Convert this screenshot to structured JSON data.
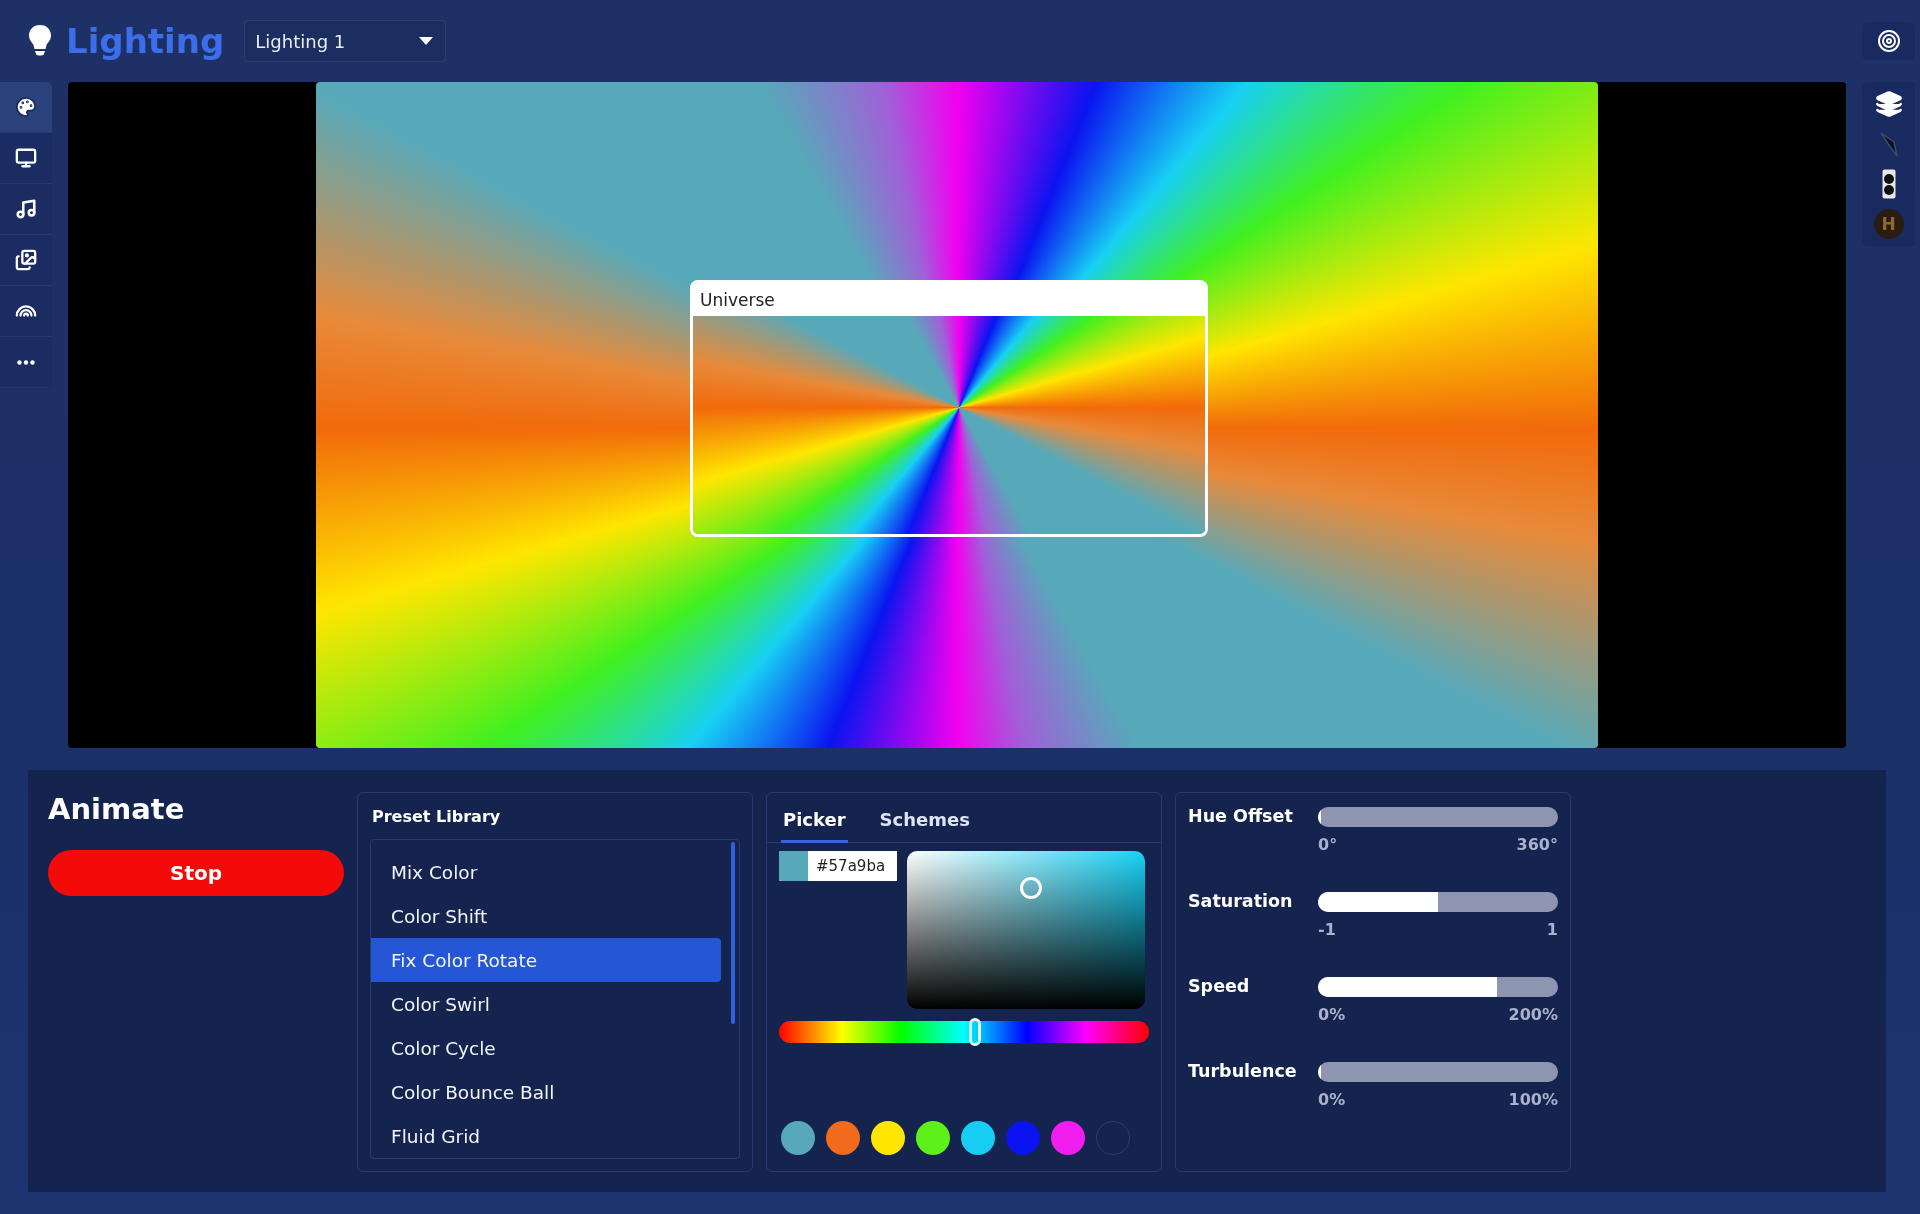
{
  "header": {
    "title": "Lighting",
    "scene_select": {
      "value": "Lighting 1"
    },
    "target_button": {
      "kind": "target"
    }
  },
  "left_toolbar": [
    {
      "kind": "palette",
      "selected": true
    },
    {
      "kind": "monitor",
      "selected": false
    },
    {
      "kind": "music",
      "selected": false
    },
    {
      "kind": "images",
      "selected": false
    },
    {
      "kind": "rainbow",
      "selected": false
    },
    {
      "kind": "more",
      "selected": false
    }
  ],
  "right_toolbar": [
    {
      "kind": "layers"
    },
    {
      "kind": "brush"
    },
    {
      "kind": "speaker"
    },
    {
      "kind": "badge",
      "letter": "H"
    }
  ],
  "preview": {
    "overlay_title": "Universe"
  },
  "animate": {
    "title": "Animate",
    "stop_button": "Stop"
  },
  "preset_library": {
    "title": "Preset Library",
    "items": [
      {
        "label": "Mix Color",
        "selected": false
      },
      {
        "label": "Color Shift",
        "selected": false
      },
      {
        "label": "Fix Color Rotate",
        "selected": true
      },
      {
        "label": "Color Swirl",
        "selected": false
      },
      {
        "label": "Color Cycle",
        "selected": false
      },
      {
        "label": "Color Bounce Ball",
        "selected": false
      },
      {
        "label": "Fluid Grid",
        "selected": false
      }
    ]
  },
  "color_picker": {
    "tabs": [
      {
        "label": "Picker",
        "selected": true
      },
      {
        "label": "Schemes",
        "selected": false
      }
    ],
    "hex_value": "#57a9ba",
    "hue": {
      "level": 0.53
    },
    "swatches": [
      {
        "kind": "color",
        "color": "#57a9ba"
      },
      {
        "kind": "color",
        "color": "#f26a1b"
      },
      {
        "kind": "color",
        "color": "#ffe600"
      },
      {
        "kind": "color",
        "color": "#5ef01a"
      },
      {
        "kind": "color",
        "color": "#18cdf4"
      },
      {
        "kind": "color",
        "color": "#0a14f0"
      },
      {
        "kind": "color",
        "color": "#f21ef0"
      },
      {
        "kind": "empty"
      }
    ]
  },
  "sliders": [
    {
      "label": "Hue Offset",
      "level": 0,
      "min": "0°",
      "max": "360°"
    },
    {
      "label": "Saturation",
      "level": 0.5,
      "min": "-1",
      "max": "1"
    },
    {
      "label": "Speed",
      "level": 0.745,
      "min": "0%",
      "max": "200%"
    },
    {
      "label": "Turbulence",
      "level": 0,
      "min": "0%",
      "max": "100%"
    }
  ]
}
